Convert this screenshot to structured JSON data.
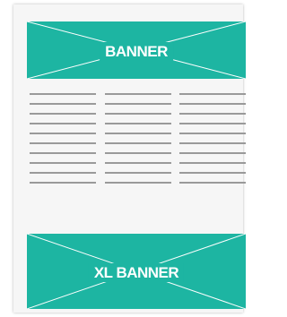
{
  "banners": {
    "top": {
      "label": "BANNER"
    },
    "bottom": {
      "label": "XL BANNER"
    }
  },
  "content": {
    "columns": 3,
    "lines_per_column": 10
  },
  "colors": {
    "banner_fill": "#1db5a2",
    "banner_text": "#ffffff",
    "text_line": "#9a9a9a",
    "page_bg": "#f6f6f6"
  }
}
